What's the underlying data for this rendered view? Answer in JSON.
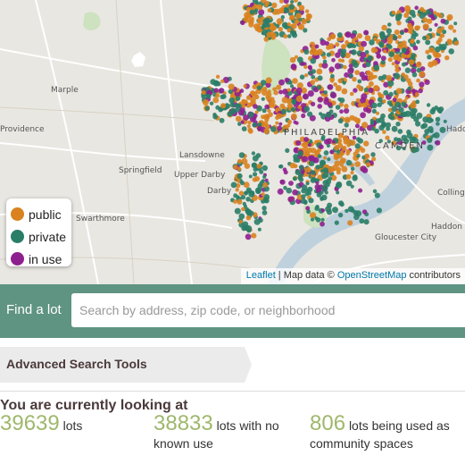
{
  "map": {
    "labels": {
      "marple": "Marple",
      "providence": "Providence",
      "lansdowne": "Lansdowne",
      "springfield": "Springfield",
      "upper_darby": "Upper Darby",
      "darby": "Darby",
      "swarthmore": "Swarthmore",
      "philadelphia": "PHILADELPHIA",
      "camden": "CAMDEN",
      "haddon": "Hadd",
      "collings": "Collings",
      "gloucester_city": "Gloucester City",
      "haddon2": "Haddon"
    },
    "colors": {
      "public": "#d9821f",
      "private": "#2a7d67",
      "in_use": "#8e1f8f",
      "water": "#bfd1dd",
      "park": "#cde2bf",
      "land": "#e9e7e2"
    }
  },
  "legend": {
    "items": [
      {
        "label": "public",
        "color": "#d9821f"
      },
      {
        "label": "private",
        "color": "#2a7d67"
      },
      {
        "label": "in use",
        "color": "#8e1f8f"
      }
    ]
  },
  "attribution": {
    "leaflet": "Leaflet",
    "sep": " | Map data © ",
    "osm": "OpenStreetMap",
    "contrib": " contributors"
  },
  "find": {
    "label": "Find a lot",
    "placeholder": "Search by address, zip code, or neighborhood"
  },
  "advanced": {
    "label": "Advanced Search Tools"
  },
  "summary": {
    "heading": "You are currently looking at",
    "stats": [
      {
        "value": "39639",
        "text": "lots"
      },
      {
        "value": "38833",
        "text": "lots with no known use"
      },
      {
        "value": "806",
        "text": "lots being used as community spaces"
      }
    ]
  }
}
